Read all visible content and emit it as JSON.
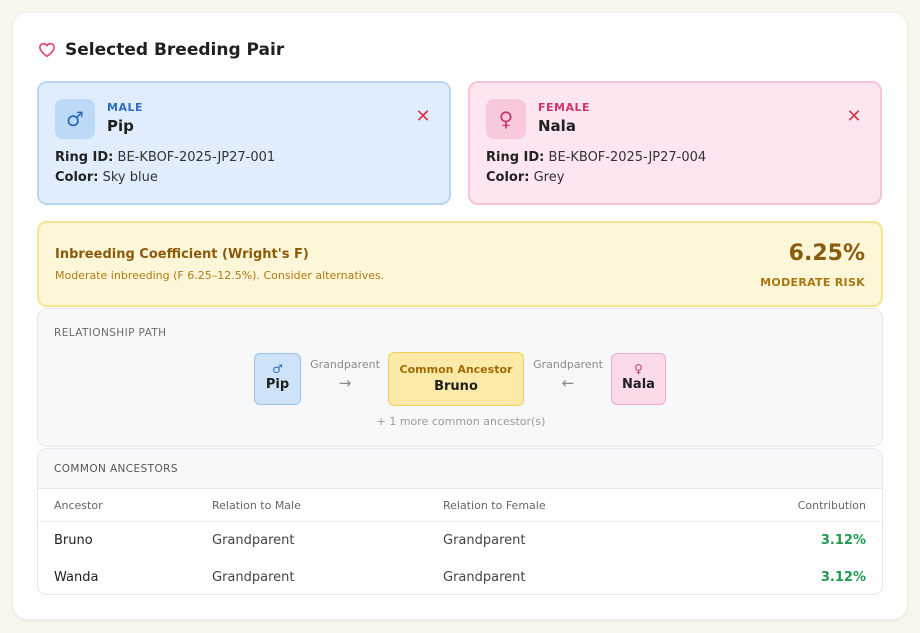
{
  "header": {
    "title": "Selected Breeding Pair",
    "icon": "heart-icon",
    "icon_color": "#e0457b"
  },
  "male": {
    "sex_label": "MALE",
    "symbol": "♂",
    "name": "Pip",
    "ring_label": "Ring ID:",
    "ring_value": "BE-KBOF-2025-JP27-001",
    "color_label": "Color:",
    "color_value": "Sky blue",
    "remove_icon": "close-icon"
  },
  "female": {
    "sex_label": "FEMALE",
    "symbol": "♀",
    "name": "Nala",
    "ring_label": "Ring ID:",
    "ring_value": "BE-KBOF-2025-JP27-004",
    "color_label": "Color:",
    "color_value": "Grey",
    "remove_icon": "close-icon"
  },
  "inbreeding": {
    "title": "Inbreeding Coefficient (Wright's F)",
    "subtitle": "Moderate inbreeding (F 6.25–12.5%). Consider alternatives.",
    "value": "6.25%",
    "risk": "MODERATE RISK",
    "accent": "#8a5b0a"
  },
  "relationship": {
    "label": "RELATIONSHIP PATH",
    "male_symbol": "♂",
    "male_name": "Pip",
    "left_relation": "Grandparent",
    "left_arrow": "→",
    "ancestor_label": "Common Ancestor",
    "ancestor_name": "Bruno",
    "right_relation": "Grandparent",
    "right_arrow": "←",
    "female_symbol": "♀",
    "female_name": "Nala",
    "more": "+ 1 more common ancestor(s)"
  },
  "ancestors": {
    "title": "COMMON ANCESTORS",
    "columns": [
      "Ancestor",
      "Relation to Male",
      "Relation to Female",
      "Contribution"
    ],
    "rows": [
      {
        "ancestor": "Bruno",
        "male_rel": "Grandparent",
        "female_rel": "Grandparent",
        "contribution": "3.12%"
      },
      {
        "ancestor": "Wanda",
        "male_rel": "Grandparent",
        "female_rel": "Grandparent",
        "contribution": "3.12%"
      }
    ],
    "contribution_color": "#1f9a4e"
  }
}
